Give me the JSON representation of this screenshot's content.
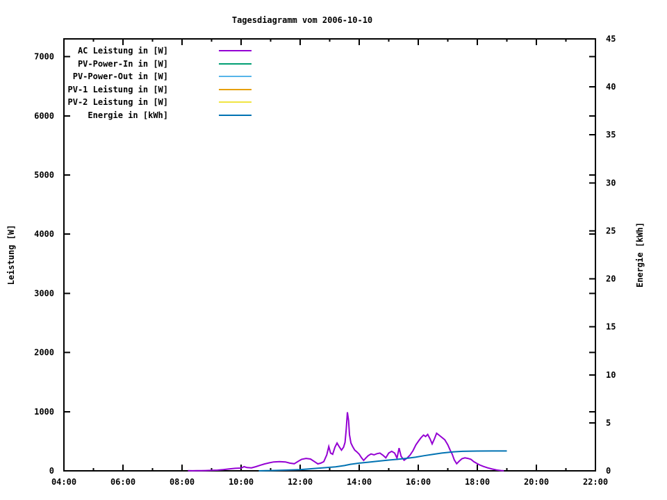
{
  "chart_data": {
    "type": "line",
    "title": "Tagesdiagramm vom 2006-10-10",
    "legend_position": "top-left-inside",
    "grid": false,
    "x_axis": {
      "unit": "time",
      "range_hours": [
        4,
        22
      ],
      "ticks": [
        {
          "hour": 4,
          "label": "04:00"
        },
        {
          "hour": 6,
          "label": "06:00"
        },
        {
          "hour": 8,
          "label": "08:00"
        },
        {
          "hour": 10,
          "label": "10:00"
        },
        {
          "hour": 12,
          "label": "12:00"
        },
        {
          "hour": 14,
          "label": "14:00"
        },
        {
          "hour": 16,
          "label": "16:00"
        },
        {
          "hour": 18,
          "label": "18:00"
        },
        {
          "hour": 20,
          "label": "20:00"
        },
        {
          "hour": 22,
          "label": "22:00"
        }
      ],
      "minor_ticks": [
        5,
        7,
        9,
        11,
        13,
        15,
        17,
        19,
        21
      ]
    },
    "y_left": {
      "label": "Leistung [W]",
      "range": [
        0,
        7300
      ],
      "ticks": [
        {
          "value": 0,
          "label": "0"
        },
        {
          "value": 1000,
          "label": "1000"
        },
        {
          "value": 2000,
          "label": "2000"
        },
        {
          "value": 3000,
          "label": "3000"
        },
        {
          "value": 4000,
          "label": "4000"
        },
        {
          "value": 5000,
          "label": "5000"
        },
        {
          "value": 6000,
          "label": "6000"
        },
        {
          "value": 7000,
          "label": "7000"
        }
      ]
    },
    "y_right": {
      "label": "Energie [kWh]",
      "range": [
        0,
        45
      ],
      "ticks": [
        {
          "value": 0,
          "label": "0"
        },
        {
          "value": 5,
          "label": "5"
        },
        {
          "value": 10,
          "label": "10"
        },
        {
          "value": 15,
          "label": "15"
        },
        {
          "value": 20,
          "label": "20"
        },
        {
          "value": 25,
          "label": "25"
        },
        {
          "value": 30,
          "label": "30"
        },
        {
          "value": 35,
          "label": "35"
        },
        {
          "value": 40,
          "label": "40"
        },
        {
          "value": 45,
          "label": "45"
        }
      ]
    },
    "series": [
      {
        "name": "AC Leistung in [W]",
        "color": "#9400d3",
        "axis": "left",
        "points": [
          [
            8.2,
            2
          ],
          [
            8.35,
            1
          ],
          [
            8.5,
            4
          ],
          [
            8.65,
            2
          ],
          [
            8.8,
            5
          ],
          [
            9.0,
            8
          ],
          [
            9.2,
            12
          ],
          [
            9.4,
            20
          ],
          [
            9.6,
            32
          ],
          [
            9.8,
            42
          ],
          [
            10.0,
            47
          ],
          [
            10.1,
            70
          ],
          [
            10.2,
            55
          ],
          [
            10.35,
            50
          ],
          [
            10.5,
            70
          ],
          [
            10.65,
            95
          ],
          [
            10.8,
            117
          ],
          [
            10.95,
            135
          ],
          [
            11.1,
            150
          ],
          [
            11.3,
            155
          ],
          [
            11.5,
            150
          ],
          [
            11.65,
            130
          ],
          [
            11.8,
            120
          ],
          [
            11.95,
            165
          ],
          [
            12.05,
            195
          ],
          [
            12.2,
            210
          ],
          [
            12.35,
            200
          ],
          [
            12.5,
            150
          ],
          [
            12.6,
            117
          ],
          [
            12.7,
            130
          ],
          [
            12.8,
            155
          ],
          [
            12.9,
            270
          ],
          [
            12.97,
            411
          ],
          [
            13.03,
            300
          ],
          [
            13.1,
            280
          ],
          [
            13.18,
            400
          ],
          [
            13.25,
            470
          ],
          [
            13.32,
            410
          ],
          [
            13.4,
            350
          ],
          [
            13.47,
            400
          ],
          [
            13.52,
            480
          ],
          [
            13.56,
            700
          ],
          [
            13.6,
            990
          ],
          [
            13.64,
            850
          ],
          [
            13.67,
            610
          ],
          [
            13.72,
            470
          ],
          [
            13.78,
            410
          ],
          [
            13.85,
            350
          ],
          [
            13.92,
            320
          ],
          [
            14.0,
            280
          ],
          [
            14.08,
            220
          ],
          [
            14.15,
            176
          ],
          [
            14.22,
            215
          ],
          [
            14.3,
            255
          ],
          [
            14.4,
            285
          ],
          [
            14.5,
            270
          ],
          [
            14.6,
            290
          ],
          [
            14.7,
            300
          ],
          [
            14.8,
            265
          ],
          [
            14.9,
            220
          ],
          [
            15.0,
            300
          ],
          [
            15.1,
            330
          ],
          [
            15.2,
            300
          ],
          [
            15.28,
            215
          ],
          [
            15.35,
            385
          ],
          [
            15.42,
            245
          ],
          [
            15.52,
            180
          ],
          [
            15.62,
            215
          ],
          [
            15.72,
            265
          ],
          [
            15.82,
            340
          ],
          [
            15.92,
            440
          ],
          [
            16.02,
            510
          ],
          [
            16.1,
            565
          ],
          [
            16.18,
            605
          ],
          [
            16.25,
            580
          ],
          [
            16.32,
            615
          ],
          [
            16.4,
            540
          ],
          [
            16.47,
            455
          ],
          [
            16.55,
            545
          ],
          [
            16.62,
            635
          ],
          [
            16.7,
            605
          ],
          [
            16.8,
            565
          ],
          [
            16.9,
            525
          ],
          [
            17.0,
            440
          ],
          [
            17.08,
            350
          ],
          [
            17.15,
            280
          ],
          [
            17.22,
            185
          ],
          [
            17.3,
            120
          ],
          [
            17.38,
            160
          ],
          [
            17.48,
            205
          ],
          [
            17.58,
            220
          ],
          [
            17.68,
            210
          ],
          [
            17.78,
            195
          ],
          [
            17.88,
            155
          ],
          [
            17.98,
            125
          ],
          [
            18.08,
            100
          ],
          [
            18.2,
            75
          ],
          [
            18.35,
            50
          ],
          [
            18.5,
            30
          ],
          [
            18.65,
            15
          ],
          [
            18.8,
            5
          ],
          [
            18.9,
            1
          ]
        ]
      },
      {
        "name": "PV-Power-In in [W]",
        "color": "#009e73",
        "axis": "left",
        "points": []
      },
      {
        "name": "PV-Power-Out in [W]",
        "color": "#56b4e9",
        "axis": "left",
        "points": []
      },
      {
        "name": "PV-1 Leistung in [W]",
        "color": "#e69f00",
        "axis": "left",
        "points": []
      },
      {
        "name": "PV-2 Leistung in [W]",
        "color": "#f0e442",
        "axis": "left",
        "points": []
      },
      {
        "name": "Energie in [kWh]",
        "color": "#0072b2",
        "axis": "right",
        "points": [
          [
            10.6,
            0.0
          ],
          [
            11.0,
            0.03
          ],
          [
            11.5,
            0.07
          ],
          [
            12.0,
            0.13
          ],
          [
            12.3,
            0.2
          ],
          [
            12.6,
            0.27
          ],
          [
            12.9,
            0.34
          ],
          [
            13.2,
            0.42
          ],
          [
            13.5,
            0.55
          ],
          [
            13.7,
            0.68
          ],
          [
            14.0,
            0.8
          ],
          [
            14.3,
            0.9
          ],
          [
            14.6,
            1.0
          ],
          [
            15.0,
            1.12
          ],
          [
            15.3,
            1.2
          ],
          [
            15.6,
            1.3
          ],
          [
            15.9,
            1.42
          ],
          [
            16.2,
            1.58
          ],
          [
            16.5,
            1.72
          ],
          [
            16.8,
            1.85
          ],
          [
            17.0,
            1.92
          ],
          [
            17.2,
            1.98
          ],
          [
            17.5,
            2.03
          ],
          [
            18.0,
            2.06
          ],
          [
            18.5,
            2.07
          ],
          [
            19.0,
            2.07
          ]
        ]
      }
    ]
  }
}
